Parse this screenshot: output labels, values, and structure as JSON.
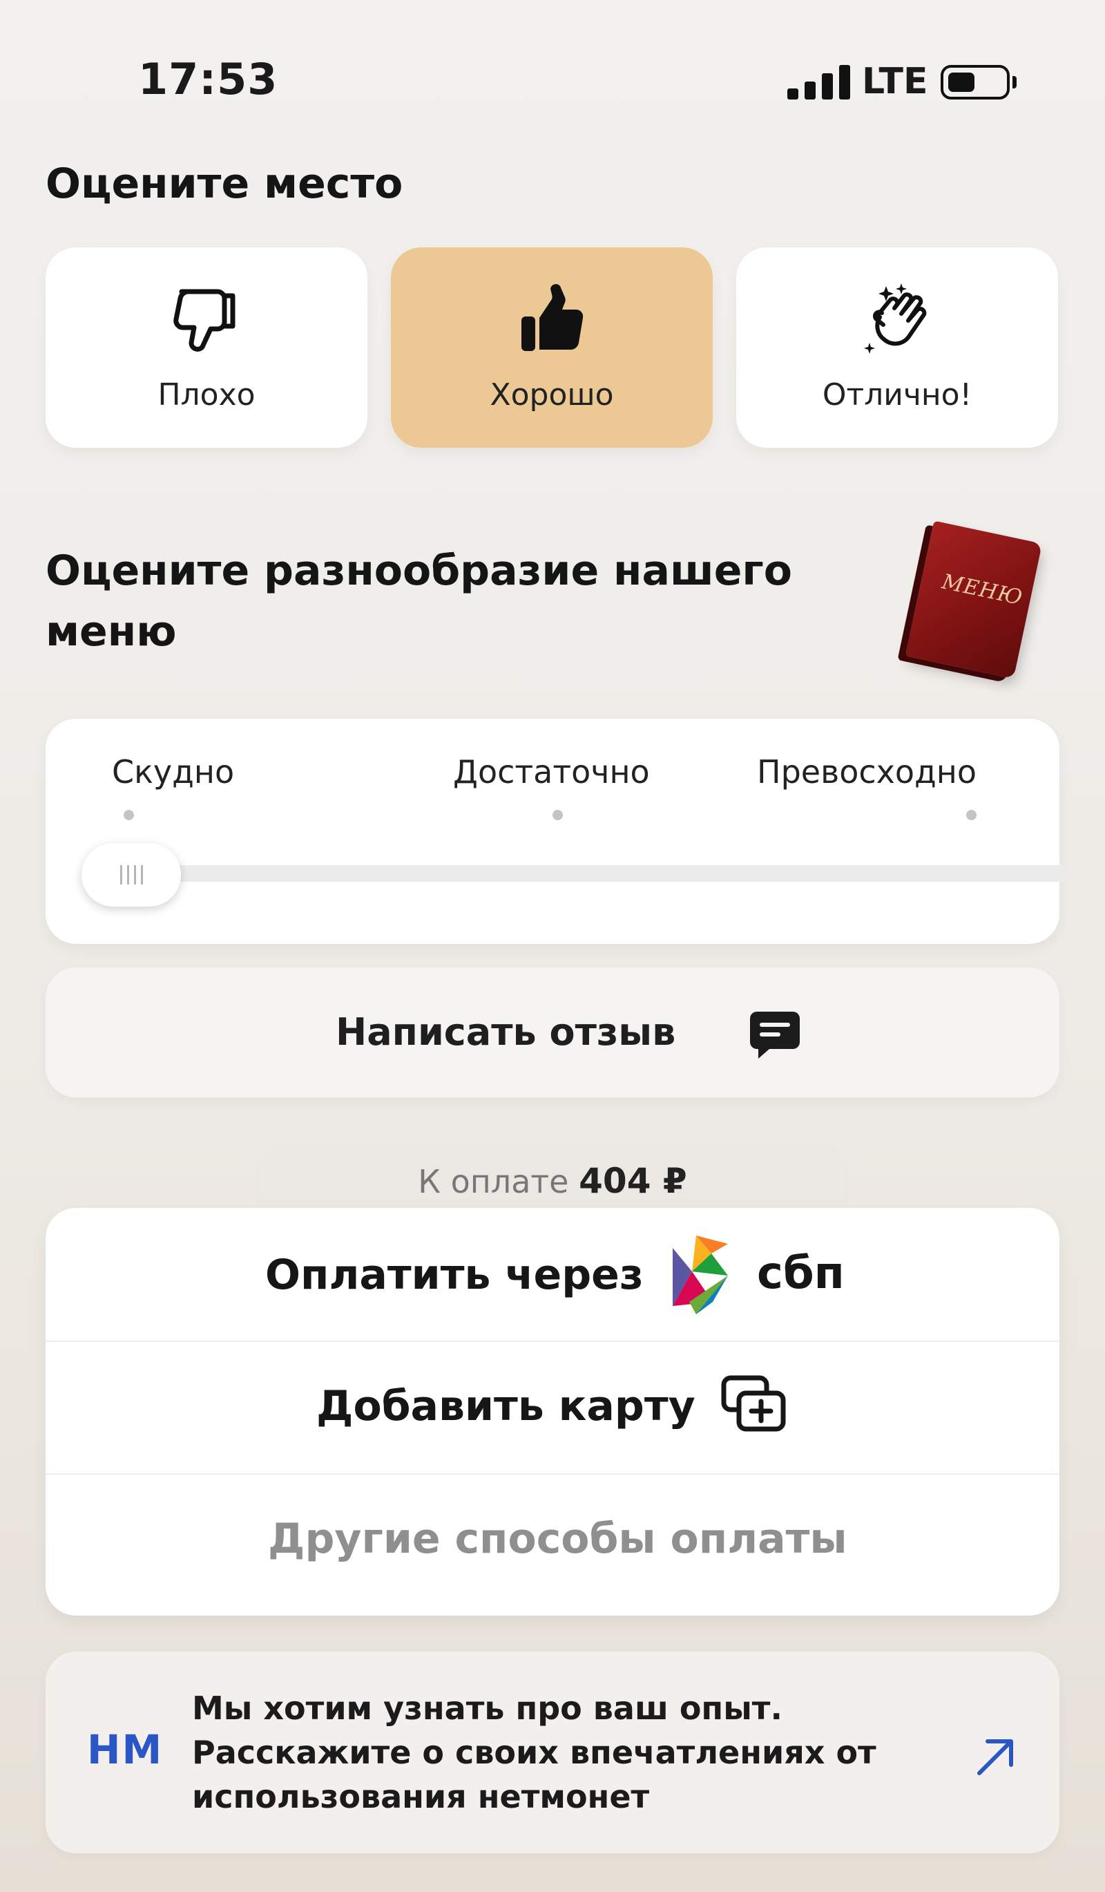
{
  "status_bar": {
    "time": "17:53",
    "network": "LTE",
    "icons": [
      "signal-bars-icon",
      "battery-icon"
    ]
  },
  "rate_place": {
    "title": "Оцените место",
    "options": [
      {
        "label": "Плохо",
        "icon": "thumbs-down-icon",
        "selected": false
      },
      {
        "label": "Хорошо",
        "icon": "thumbs-up-icon",
        "selected": true
      },
      {
        "label": "Отлично!",
        "icon": "clapping-hands-icon",
        "selected": false
      }
    ],
    "selected_color": "#ecc894"
  },
  "rate_menu": {
    "title": "Оцените разнообразие нашего меню",
    "illustration_text": "МЕНЮ",
    "slider": {
      "labels": [
        "Скудно",
        "Достаточно",
        "Превосходно"
      ],
      "value": 0
    }
  },
  "review": {
    "label": "Написать отзыв",
    "icon": "chat-bubble-icon"
  },
  "payment": {
    "amount_caption": "К оплате",
    "amount": "404 ₽",
    "sbp_label": "Оплатить через",
    "sbp_logo_text": "сбп",
    "add_card_label": "Добавить карту",
    "add_card_icon": "add-card-icon",
    "other_label": "Другие способы оплаты"
  },
  "feedback": {
    "logo": "НМ",
    "text": "Мы хотим узнать про ваш опыт. Расскажите о своих впечатлениях от использования нетмонет",
    "icon": "arrow-up-right-icon",
    "accent_color": "#2a56c6"
  }
}
